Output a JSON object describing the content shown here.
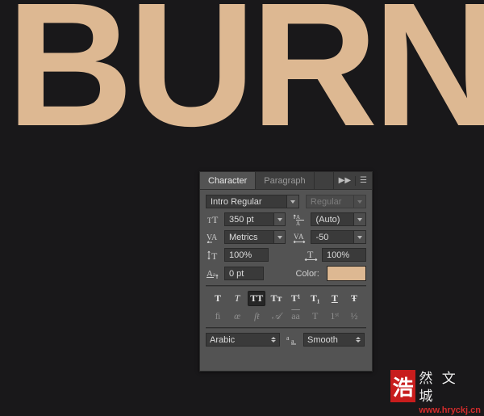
{
  "canvas": {
    "background_color": "#19181a",
    "text": "BURN",
    "text_color": "#ddb892"
  },
  "panel": {
    "tabs": [
      {
        "label": "Character",
        "active": true
      },
      {
        "label": "Paragraph",
        "active": false
      }
    ],
    "collapse_icon": "double-chevron-right-icon",
    "menu_icon": "panel-menu-icon",
    "font": {
      "family_value": "Intro  Regular",
      "style_value": "Regular",
      "style_disabled": true
    },
    "metrics": {
      "size_icon": "font-size-icon",
      "size_value": "350 pt",
      "leading_icon": "leading-icon",
      "leading_value": "(Auto)",
      "kerning_icon": "kerning-icon",
      "kerning_value": "Metrics",
      "tracking_icon": "tracking-icon",
      "tracking_value": "-50"
    },
    "scale": {
      "vertical_icon": "vertical-scale-icon",
      "vertical_value": "100%",
      "horizontal_icon": "horizontal-scale-icon",
      "horizontal_value": "100%",
      "baseline_icon": "baseline-shift-icon",
      "baseline_value": "0 pt",
      "color_label": "Color:",
      "color_value": "#ddb892"
    },
    "style_buttons": [
      {
        "name": "faux-bold",
        "glyph": "T",
        "state": "off"
      },
      {
        "name": "faux-italic",
        "glyph": "T",
        "state": "off"
      },
      {
        "name": "all-caps",
        "glyph": "TT",
        "state": "on"
      },
      {
        "name": "small-caps",
        "glyph": "Tт",
        "state": "off"
      },
      {
        "name": "superscript",
        "glyph": "T¹",
        "state": "off"
      },
      {
        "name": "subscript",
        "glyph": "T₁",
        "state": "off"
      },
      {
        "name": "underline",
        "glyph": "T",
        "state": "off"
      },
      {
        "name": "strikethrough",
        "glyph": "Ŧ",
        "state": "off"
      }
    ],
    "opentype_buttons": [
      {
        "name": "standard-ligatures",
        "glyph": "ﬁ"
      },
      {
        "name": "discretionary-ligatures",
        "glyph": "œ"
      },
      {
        "name": "contextual-alternates",
        "glyph": "ſŧ"
      },
      {
        "name": "swash",
        "glyph": "𝒜"
      },
      {
        "name": "stylistic-alternates",
        "glyph": "aa"
      },
      {
        "name": "titling-alternates",
        "glyph": "T"
      },
      {
        "name": "ordinals",
        "glyph": "1ˢᵗ"
      },
      {
        "name": "fractions",
        "glyph": "½"
      }
    ],
    "footer": {
      "language_value": "Arabic",
      "antialias_icon": "anti-aliasing-icon",
      "antialias_value": "Smooth"
    }
  },
  "watermark": {
    "seal_char": "浩",
    "name": "然 文 城",
    "url": "www.hryckj.cn",
    "seal_color": "#c81d1d"
  }
}
